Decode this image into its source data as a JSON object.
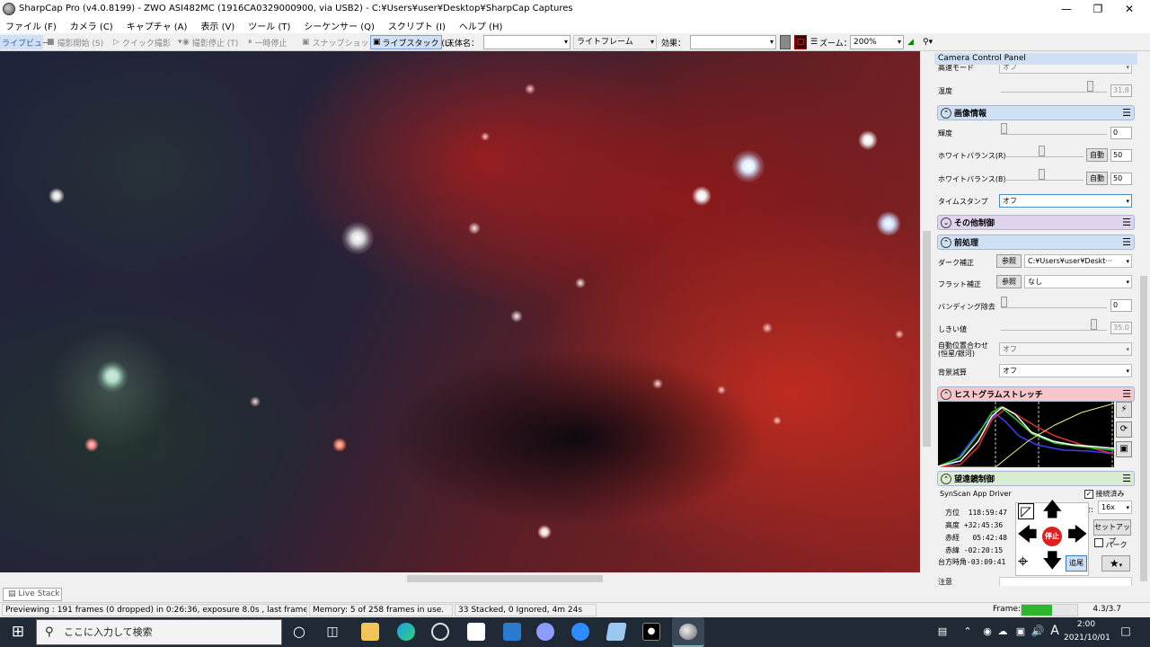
{
  "window": {
    "title": "SharpCap Pro (v4.0.8199) - ZWO ASI482MC (1916CA0329000900, via USB2) - C:¥Users¥user¥Desktop¥SharpCap Captures"
  },
  "menu": [
    "ファイル (F)",
    "カメラ (C)",
    "キャプチャ (A)",
    "表示 (V)",
    "ツール (T)",
    "シーケンサー (Q)",
    "スクリプト (I)",
    "ヘルプ (H)"
  ],
  "toolbar": {
    "live_view": "ライブビュー",
    "start_capture": "撮影開始 (S)",
    "quick_capture": "クイック撮影",
    "stop_capture": "撮影停止 (T)",
    "pause": "一時停止",
    "snapshot": "スナップショット",
    "live_stack": "ライブスタック (L)",
    "target_label": "天体名：",
    "target_value": "",
    "frame_type": "ライトフレーム",
    "effect_label": "効果：",
    "effect_value": "",
    "zoom_label": "ズーム：",
    "zoom_value": "200%"
  },
  "panel": {
    "title": "Camera Control Panel",
    "high_speed_label": "高速モード",
    "high_speed_value": "オフ",
    "temperature_label": "温度",
    "temperature_value": "31.8",
    "image_section": "画像情報",
    "brightness_label": "輝度",
    "brightness_value": "0",
    "wb_r_label": "ホワイトバランス(R)",
    "wb_r_auto": "自動",
    "wb_r_value": "50",
    "wb_b_label": "ホワイトバランス(B)",
    "wb_b_auto": "自動",
    "wb_b_value": "50",
    "timestamp_label": "タイムスタンプ",
    "timestamp_value": "オフ",
    "other_section": "その他制御",
    "preprocess_section": "前処理",
    "dark_label": "ダーク補正",
    "dark_browse": "参照",
    "dark_value": "C:¥Users¥user¥Deskt···",
    "flat_label": "フラット補正",
    "flat_browse": "参照",
    "flat_value": "なし",
    "banding_label": "バンディング除去",
    "banding_value": "0",
    "threshold_label": "しきい値",
    "threshold_value": "35.0",
    "autoalign_label": "自動位置合わせ (恒星/銀河)",
    "autoalign_value": "オフ",
    "bgsub_label": "背景減算",
    "bgsub_value": "オフ",
    "histogram_section": "ヒストグラムストレッチ",
    "telescope_section": "望遠鏡制御",
    "driver": "SynScan App Driver",
    "connected_label": "接続済み",
    "rate_label": "割合:",
    "rate_value": "16x",
    "az_label": "方位",
    "az_value": "118:59:47",
    "alt_label": "高度",
    "alt_value": "+32:45:36",
    "ra_label": "赤経",
    "ra_value": "05:42:48",
    "dec_label": "赤緯",
    "dec_value": "-02:20:15",
    "lst_label": "台方時角",
    "lst_value": "-03:09:41",
    "stop_label": "停止",
    "setup_label": "セットアップ",
    "park_label": "パーク",
    "track_label": "追尾",
    "notes_label": "注意"
  },
  "bottom": {
    "live_stack_tab": "Live Stack"
  },
  "status": {
    "preview": "Previewing : 191 frames (0 dropped) in 0:26:36, exposure 8.0s , last frame 8.3s",
    "memory": "Memory: 5 of 258 frames in use.",
    "stack": "33 Stacked, 0 Ignored, 4m 24s",
    "frame_label": "Frame:",
    "frame_progress": 0.55,
    "frame_time": "4.3/3.7"
  },
  "taskbar": {
    "search_placeholder": "ここに入力して検索",
    "ime": "A",
    "time": "2:00",
    "date": "2021/10/01"
  },
  "colors": {
    "accent": "#cfe0f5",
    "histogram_pink": "#f7c6cc",
    "telescope_green": "#d8ecd0",
    "other_purple": "#e0d4ec",
    "stop_red": "#e02020"
  }
}
